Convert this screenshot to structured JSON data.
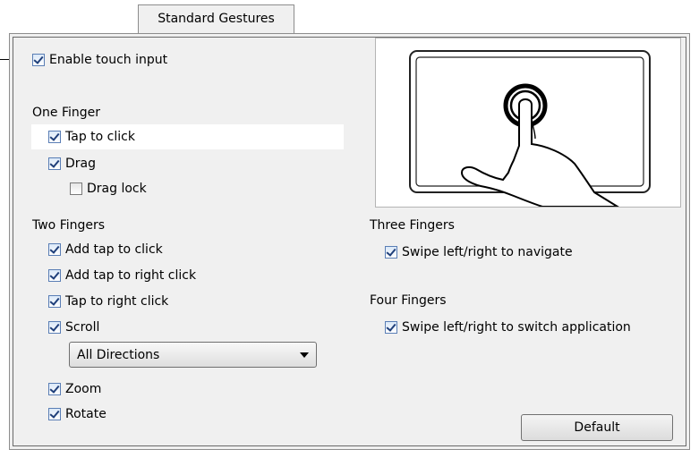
{
  "tab": {
    "label": "Standard Gestures"
  },
  "enable_touch": {
    "label": "Enable touch input",
    "checked": true
  },
  "one_finger": {
    "heading": "One Finger",
    "items": [
      {
        "label": "Tap to click",
        "checked": true
      },
      {
        "label": "Drag",
        "checked": true
      },
      {
        "label": "Drag lock",
        "checked": false
      }
    ]
  },
  "two_fingers": {
    "heading": "Two Fingers",
    "items": [
      {
        "label": "Add tap to click",
        "checked": true
      },
      {
        "label": "Add tap to right click",
        "checked": true
      },
      {
        "label": "Tap to right click",
        "checked": true
      },
      {
        "label": "Scroll",
        "checked": true
      },
      {
        "label": "Zoom",
        "checked": true
      },
      {
        "label": "Rotate",
        "checked": true
      }
    ],
    "scroll_direction": "All Directions"
  },
  "three_fingers": {
    "heading": "Three Fingers",
    "items": [
      {
        "label": "Swipe left/right to navigate",
        "checked": true
      }
    ]
  },
  "four_fingers": {
    "heading": "Four Fingers",
    "items": [
      {
        "label": "Swipe left/right to switch application",
        "checked": true
      }
    ]
  },
  "gesture_image": {
    "icon": "touchpad-tap-icon"
  },
  "default_button": {
    "label": "Default"
  }
}
